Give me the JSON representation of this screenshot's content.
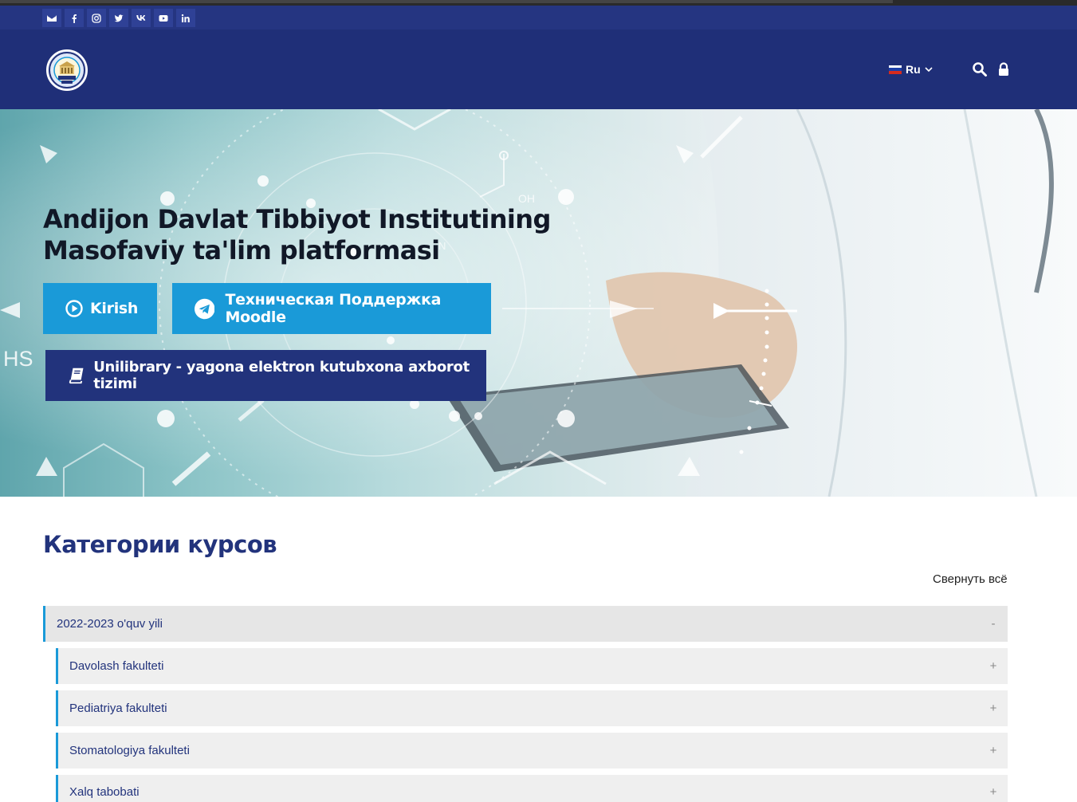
{
  "social": [
    "envelope-icon",
    "facebook-icon",
    "instagram-icon",
    "twitter-icon",
    "vk-icon",
    "youtube-icon",
    "linkedin-icon"
  ],
  "header": {
    "language": "Ru",
    "colors": {
      "topbar": "#253581",
      "header": "#1f2f78"
    }
  },
  "hero": {
    "title": "Andijon Davlat Tibbiyot Institutining Masofaviy ta'lim platformasi",
    "buttons": {
      "kirish": "Kirish",
      "support": "Техническая Поддержка Moodle",
      "library": "Unilibrary - yagona elektron kutubxona axborot tizimi"
    },
    "art_text": {
      "oh": "OH",
      "n": "N",
      "hs": "HS"
    }
  },
  "categories": {
    "title": "Категории курсов",
    "collapse_all": "Свернуть всё",
    "main": {
      "label": "2022-2023 o'quv yili",
      "toggle": "-"
    },
    "items": [
      {
        "label": "Davolash fakulteti",
        "toggle": "+"
      },
      {
        "label": "Pediatriya fakulteti",
        "toggle": "+"
      },
      {
        "label": "Stomatologiya fakulteti",
        "toggle": "+"
      },
      {
        "label": "Xalq tabobati",
        "toggle": "+"
      }
    ]
  },
  "accent": {
    "primary_button": "#1a9ad8",
    "dark_button": "#22337c"
  }
}
